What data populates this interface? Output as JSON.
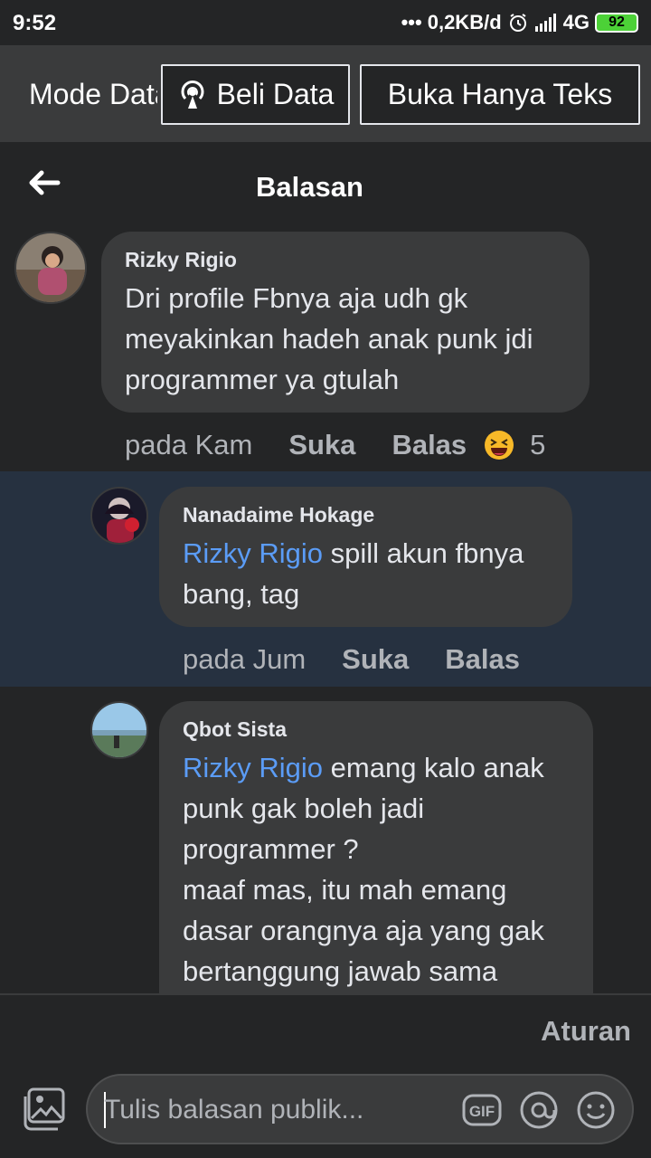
{
  "status": {
    "time": "9:52",
    "net": "0,2KB/d",
    "network_type": "4G",
    "battery": "92"
  },
  "databar": {
    "mode_label": "Mode Data",
    "beli_label": "Beli Data",
    "buka_label": "Buka Hanya Teks"
  },
  "header": {
    "title": "Balasan"
  },
  "comments": [
    {
      "author": "Rizky Rigio",
      "body": "Dri profile Fbnya aja udh gk meyakinkan hadeh anak punk jdi programmer ya gtulah",
      "time": "pada Kam",
      "like": "Suka",
      "reply": "Balas",
      "reaction_count": "5"
    },
    {
      "author": "Nanadaime Hokage",
      "mention": "Rizky Rigio",
      "body": " spill akun fbnya bang, tag",
      "time": "pada Jum",
      "like": "Suka",
      "reply": "Balas"
    },
    {
      "author": "Qbot Sista",
      "mention": "Rizky Rigio",
      "body_line1": " emang kalo anak punk gak boleh jadi programmer ?",
      "body_line2": "maaf mas, itu mah emang dasar orangnya aja yang gak bertanggung jawab sama"
    }
  ],
  "footer": {
    "rules_label": "Aturan",
    "reply_placeholder": "Tulis balasan publik...",
    "gif_label": "GIF"
  },
  "colors": {
    "mention": "#5b9cf6",
    "highlight": "#263140",
    "bubble": "#3a3b3c"
  }
}
